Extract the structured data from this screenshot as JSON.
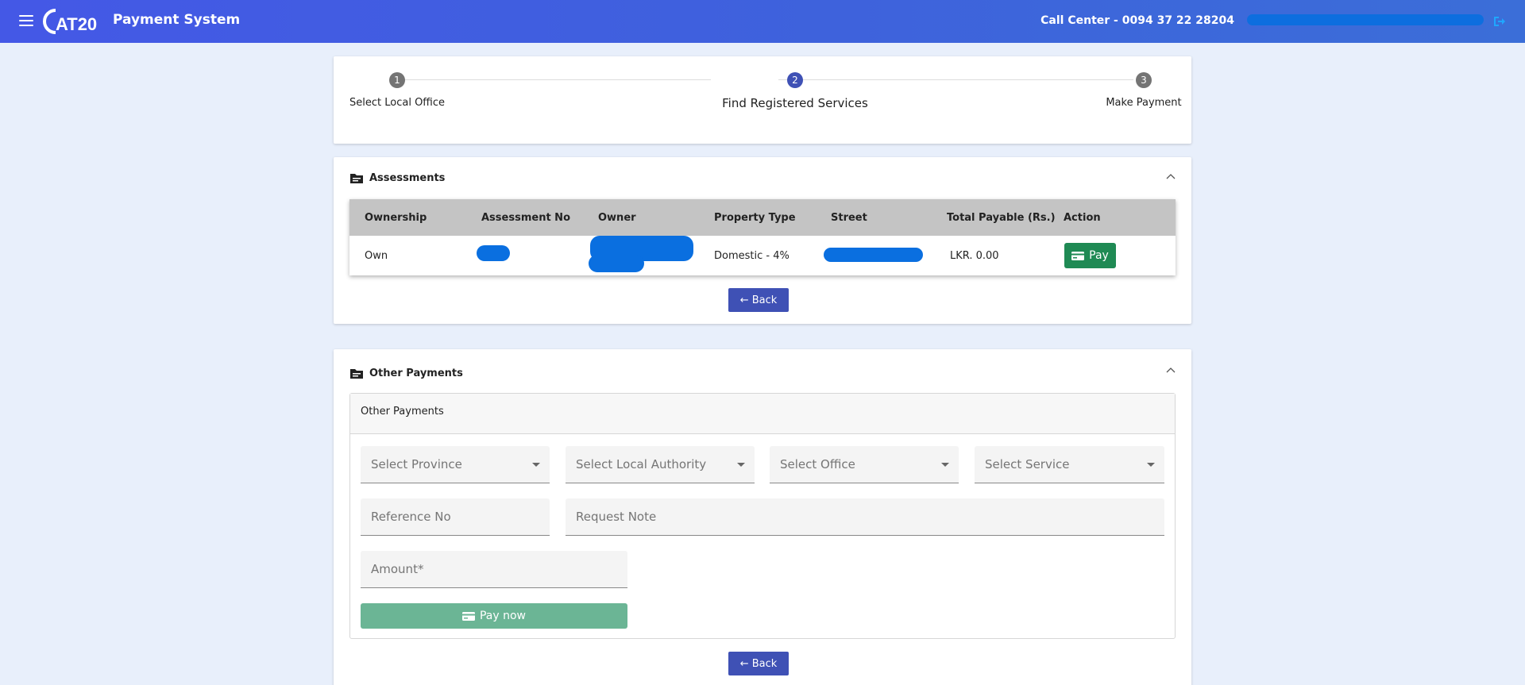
{
  "header": {
    "logo_text": "AT20",
    "title": "Payment System",
    "call_center": "Call Center - 0094 37 22 28204"
  },
  "stepper": {
    "steps": [
      {
        "number": "1",
        "label": "Select Local Office",
        "state": "done"
      },
      {
        "number": "2",
        "label": "Find Registered Services",
        "state": "active"
      },
      {
        "number": "3",
        "label": "Make Payment",
        "state": "pending"
      }
    ]
  },
  "assessments": {
    "title": "Assessments",
    "columns": [
      "Ownership",
      "Assessment No",
      "Owner",
      "Property Type",
      "Street",
      "Total Payable (Rs.)",
      "Action"
    ],
    "rows": [
      {
        "ownership": "Own",
        "property_type": "Domestic - 4%",
        "total_payable": "LKR. 0.00",
        "action": "Pay"
      }
    ],
    "back_label": "← Back"
  },
  "other_payments": {
    "title": "Other Payments",
    "inner_title": "Other Payments",
    "province_placeholder": "Select Province",
    "local_authority_placeholder": "Select Local Authority",
    "office_placeholder": "Select Office",
    "service_placeholder": "Select Service",
    "reference_placeholder": "Reference No",
    "request_note_placeholder": "Request Note",
    "amount_placeholder": "Amount*",
    "pay_now_label": "Pay now",
    "back_label": "← Back"
  },
  "colors": {
    "primary": "#3f51b5",
    "pay_green": "#1f8a54",
    "pay_now_disabled": "#6bb595",
    "background": "#e8effb"
  }
}
